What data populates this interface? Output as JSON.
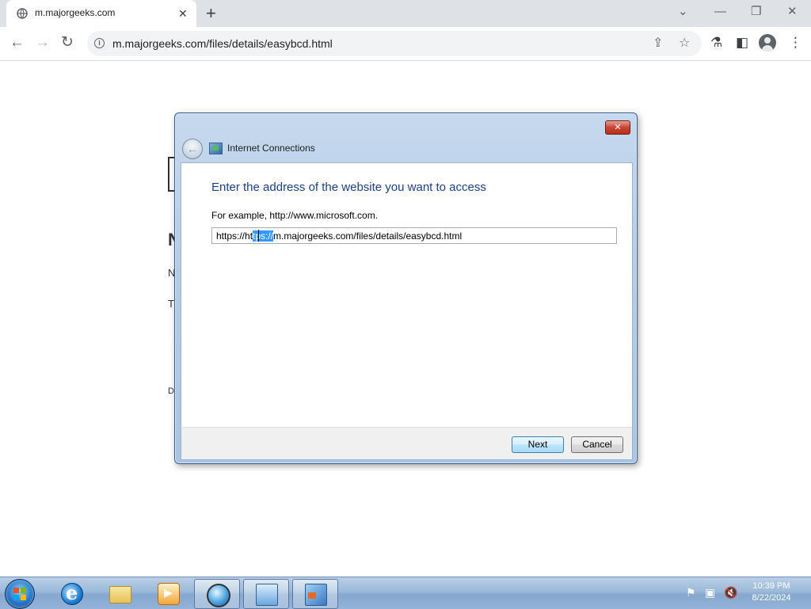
{
  "browser": {
    "tab_title": "m.majorgeeks.com",
    "tab_close": "✕",
    "new_tab": "+",
    "url": "m.majorgeeks.com/files/details/easybcd.html",
    "window_controls": {
      "dropdown": "⌄",
      "minimize": "—",
      "restore": "❐",
      "close": "✕"
    }
  },
  "page_behind": {
    "fragments": [
      "N",
      "N",
      "T",
      "D"
    ]
  },
  "dialog": {
    "title": "Internet Connections",
    "close": "✕",
    "heading": "Enter the address of the website you want to access",
    "example": "For example, http://www.microsoft.com.",
    "input": {
      "before_selection": "https://ht",
      "selected": "tps://",
      "after_selection": "m.majorgeeks.com/files/details/easybcd.html"
    },
    "buttons": {
      "next": "Next",
      "cancel": "Cancel"
    }
  },
  "taskbar": {
    "items": [
      "start",
      "internet-explorer",
      "windows-explorer",
      "media-player",
      "browser",
      "network-connections",
      "internet-connections"
    ],
    "clock": {
      "time": "10:39 PM",
      "date": "8/22/2024"
    }
  }
}
